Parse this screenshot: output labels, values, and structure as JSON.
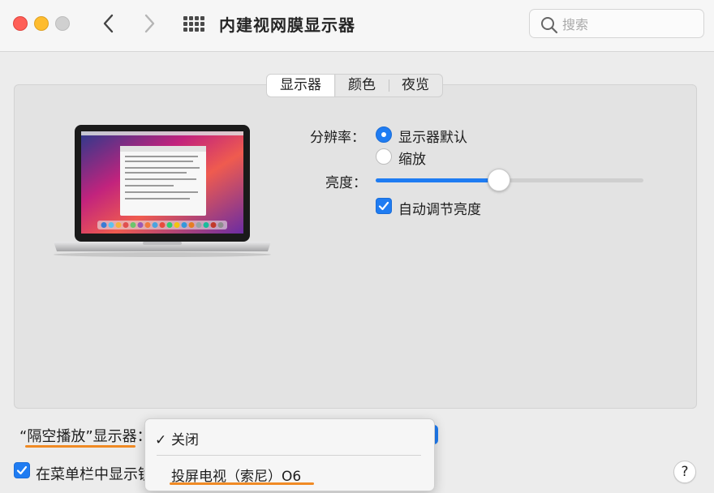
{
  "window": {
    "title": "内建视网膜显示器"
  },
  "search": {
    "placeholder": "搜索"
  },
  "tabs": [
    {
      "label": "显示器",
      "active": true
    },
    {
      "label": "颜色",
      "active": false
    },
    {
      "label": "夜览",
      "active": false
    }
  ],
  "resolution": {
    "label": "分辨率：",
    "options": [
      {
        "label": "显示器默认",
        "selected": true
      },
      {
        "label": "缩放",
        "selected": false
      }
    ]
  },
  "brightness": {
    "label": "亮度：",
    "value": 0.46,
    "auto_label": "自动调节亮度",
    "auto_checked": true
  },
  "airplay": {
    "label": "“隔空播放”显示器：",
    "options": [
      {
        "label": "关闭",
        "checked": true
      },
      {
        "label": "投屏电视（索尼）O6",
        "checked": false
      }
    ]
  },
  "menubar": {
    "label": "在菜单栏中显示镜",
    "checked": true
  },
  "help": {
    "label": "?"
  },
  "colors": {
    "accent": "#1f7cf2",
    "highlight": "#f08a24"
  }
}
